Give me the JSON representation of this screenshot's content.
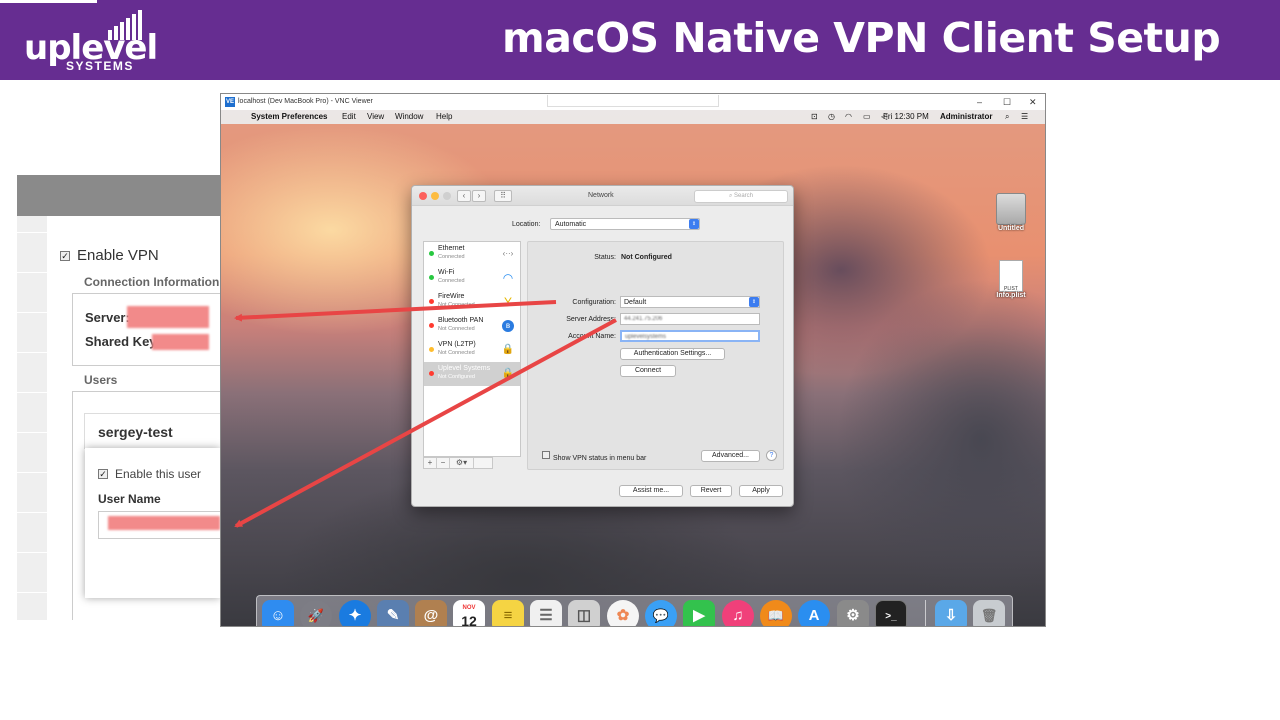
{
  "slide": {
    "title": "macOS Native VPN Client Setup",
    "logo": {
      "word": "uplevel",
      "sub": "SYSTEMS"
    },
    "colors": {
      "brand": "#662d91",
      "arrow": "#e84545",
      "redaction": "#f28a8a"
    }
  },
  "admin_panel": {
    "enable_vpn_label": "Enable VPN",
    "connection_info_label": "Connection Information",
    "server_label": "Server:",
    "shared_key_label": "Shared Key:",
    "users_label": "Users",
    "user_name_value": "sergey-test",
    "enable_user_label": "Enable this user",
    "user_name_label": "User Name"
  },
  "vnc": {
    "window_title": "localhost (Dev MacBook Pro) - VNC Viewer",
    "app_icon": "VE",
    "controls": {
      "minimize": "–",
      "maximize": "☐",
      "close": "✕"
    },
    "menubar": {
      "apple": "",
      "app": "System Preferences",
      "items": [
        "Edit",
        "View",
        "Window",
        "Help"
      ],
      "clock": "Fri 12:30 PM",
      "user": "Administrator"
    },
    "desktop_icons": [
      {
        "label": "Untitled",
        "icon": "hard-drive-icon"
      },
      {
        "label": "Info.plist",
        "icon": "plist-file-icon",
        "badge": "PLIST"
      }
    ]
  },
  "network": {
    "title": "Network",
    "search_placeholder": "Search",
    "location_label": "Location:",
    "location_value": "Automatic",
    "services": [
      {
        "name": "Ethernet",
        "status": "Connected",
        "dot": "#28c840",
        "icon": "‹··›"
      },
      {
        "name": "Wi-Fi",
        "status": "Connected",
        "dot": "#28c840",
        "icon": "◠"
      },
      {
        "name": "FireWire",
        "status": "Not Connected",
        "dot": "#ff3b30",
        "icon": "Y"
      },
      {
        "name": "Bluetooth PAN",
        "status": "Not Connected",
        "dot": "#ff3b30",
        "icon": "ʙ"
      },
      {
        "name": "VPN (L2TP)",
        "status": "Not Connected",
        "dot": "#ffbd2e",
        "icon": "🔒"
      },
      {
        "name": "Uplevel Systems",
        "status": "Not Configured",
        "dot": "#ff3b30",
        "icon": "🔒"
      }
    ],
    "list_footer": [
      "+",
      "−",
      "⚙▾"
    ],
    "status_label": "Status:",
    "status_value": "Not Configured",
    "configuration_label": "Configuration:",
    "configuration_value": "Default",
    "server_address_label": "Server Address:",
    "server_address_value": "44.241.75.206",
    "account_name_label": "Account Name:",
    "account_name_value": "uplevelsystems",
    "auth_button": "Authentication Settings...",
    "connect_button": "Connect",
    "show_vpn_label": "Show VPN status in menu bar",
    "advanced_button": "Advanced...",
    "help_button": "?",
    "assist_button": "Assist me...",
    "revert_button": "Revert",
    "apply_button": "Apply"
  },
  "dock": {
    "calendar_month": "NOV",
    "calendar_day": "12",
    "apps": [
      {
        "name": "finder-icon",
        "glyph": "☺",
        "color": "#2f8cf0"
      },
      {
        "name": "launchpad-icon",
        "glyph": "🚀",
        "color": "#8a8a8a"
      },
      {
        "name": "safari-icon",
        "glyph": "✦",
        "color": "#1a7be0"
      },
      {
        "name": "preview-icon",
        "glyph": "✎",
        "color": "#5a7fb0"
      },
      {
        "name": "contacts-icon",
        "glyph": "@",
        "color": "#b08050"
      },
      {
        "name": "calendar-icon",
        "glyph": "",
        "color": "#ffffff"
      },
      {
        "name": "notes-icon",
        "glyph": "≡",
        "color": "#f5d443"
      },
      {
        "name": "reminders-icon",
        "glyph": "☰",
        "color": "#f0f0f0"
      },
      {
        "name": "photo-booth-icon",
        "glyph": "◫",
        "color": "#d0d0d0"
      },
      {
        "name": "photos-icon",
        "glyph": "✿",
        "color": "#f5f5f5"
      },
      {
        "name": "messages-icon",
        "glyph": "💬",
        "color": "#3aa0f5"
      },
      {
        "name": "facetime-icon",
        "glyph": "▶",
        "color": "#33c24d"
      },
      {
        "name": "itunes-icon",
        "glyph": "♫",
        "color": "#f0407a"
      },
      {
        "name": "ibooks-icon",
        "glyph": "📖",
        "color": "#f08a1a"
      },
      {
        "name": "app-store-icon",
        "glyph": "A",
        "color": "#2a8ef0"
      },
      {
        "name": "system-preferences-icon",
        "glyph": "⚙",
        "color": "#8a8a8a"
      },
      {
        "name": "terminal-icon",
        "glyph": ">_",
        "color": "#222222"
      },
      {
        "name": "downloads-icon",
        "glyph": "⇩",
        "color": "#5aa8e8"
      },
      {
        "name": "trash-icon",
        "glyph": "🗑",
        "color": "#c8ccd0"
      }
    ]
  }
}
